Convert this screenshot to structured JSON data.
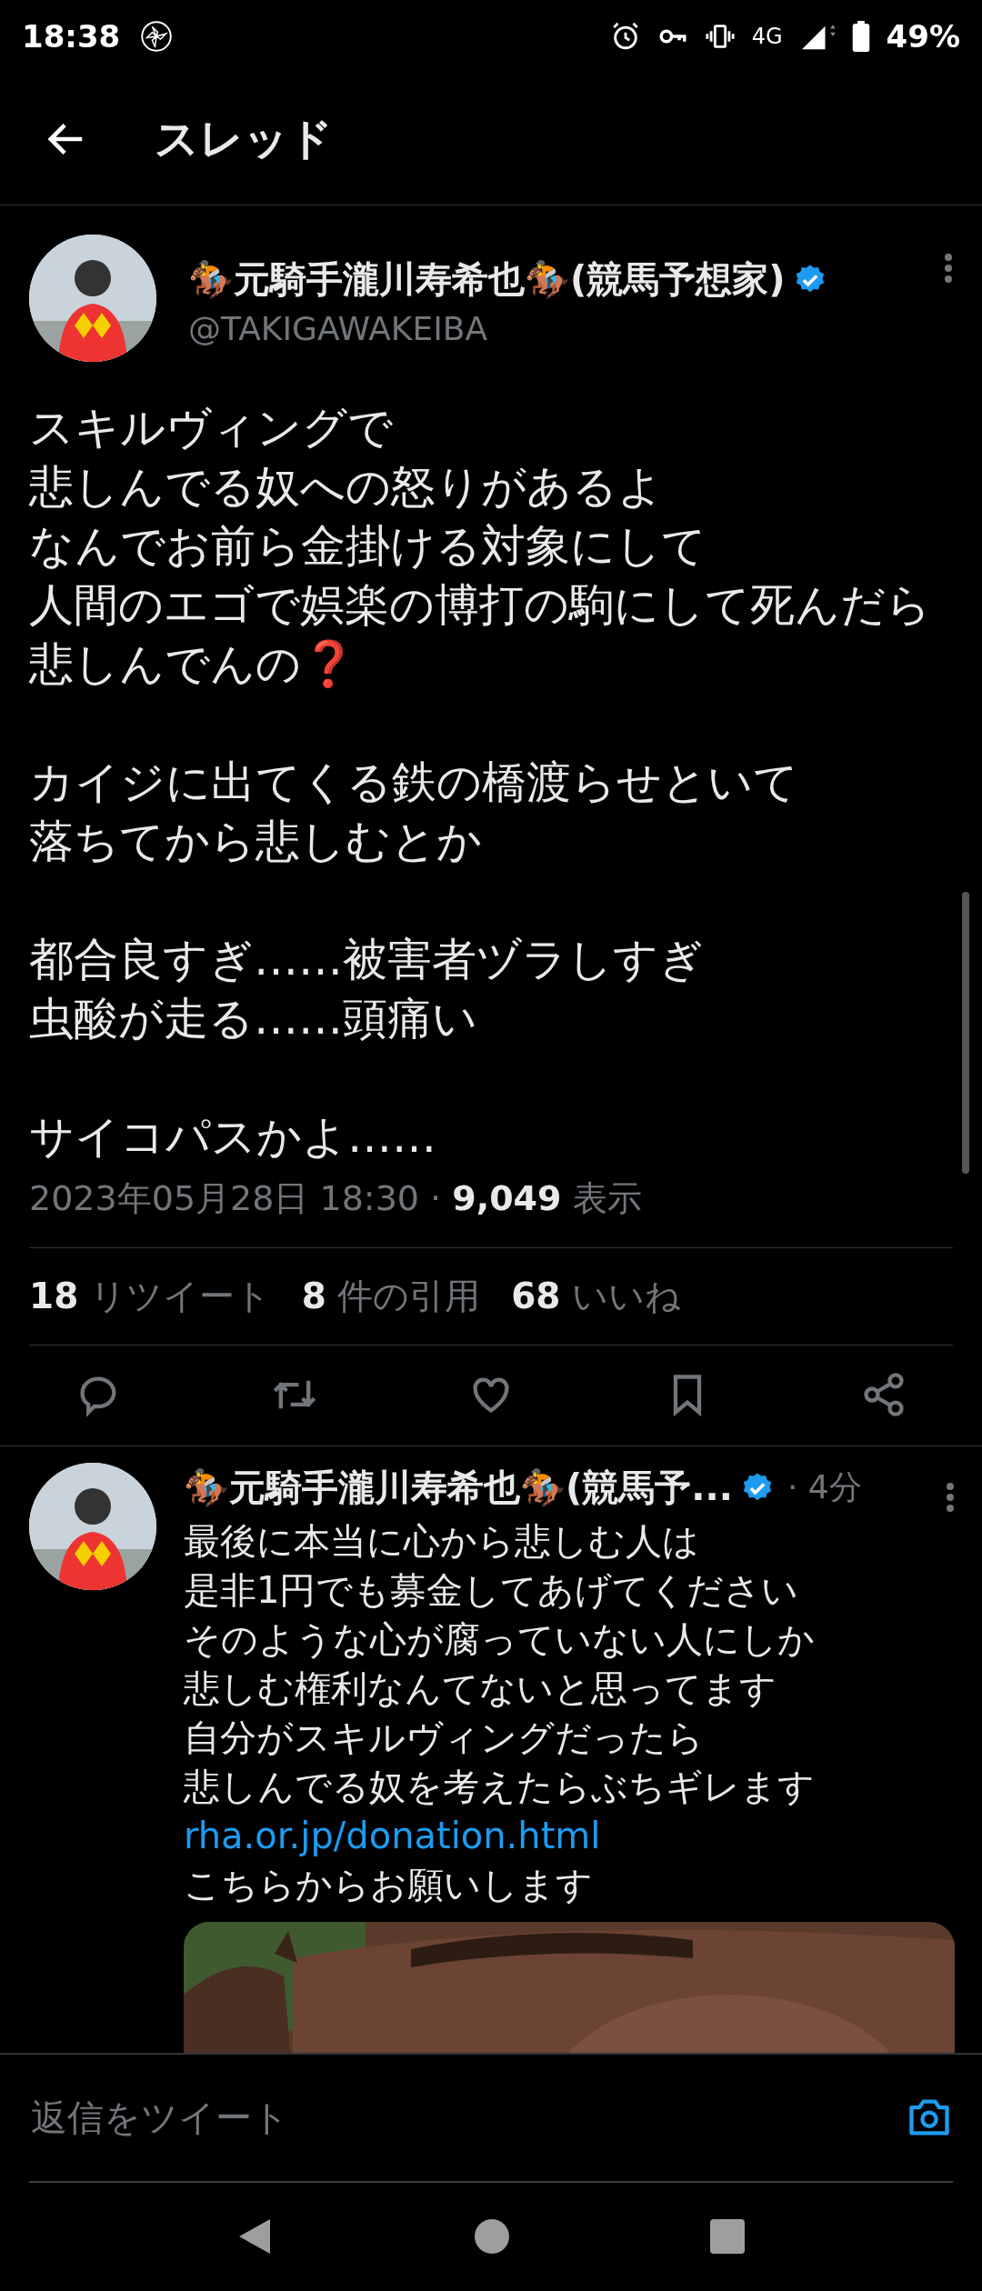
{
  "status_bar": {
    "time": "18:38",
    "network": "4G",
    "battery": "49%"
  },
  "header": {
    "title": "スレッド"
  },
  "tweet": {
    "name": "🏇元騎手瀧川寿希也🏇(競馬予想家)",
    "verified": true,
    "handle": "@TAKIGAWAKEIBA",
    "paragraphs": [
      [
        "スキルヴィングで",
        "悲しんでる奴への怒りがあるよ",
        "なんでお前ら金掛ける対象にして",
        "人間のエゴで娯楽の博打の駒にして死んだら",
        "悲しんでんの❓"
      ],
      [
        "カイジに出てくる鉄の橋渡らせといて",
        "落ちてから悲しむとか"
      ],
      [
        "都合良すぎ……被害者ヅラしすぎ",
        "虫酸が走る……頭痛い"
      ],
      [
        "サイコパスかよ……"
      ]
    ],
    "timestamp": "2023年05月28日 18:30",
    "separator": "·",
    "views_count": "9,049",
    "views_label": "表示",
    "stats": [
      {
        "count": "18",
        "label": "リツイート"
      },
      {
        "count": "8",
        "label": "件の引用"
      },
      {
        "count": "68",
        "label": "いいね"
      }
    ]
  },
  "reply": {
    "name": "🏇元騎手瀧川寿希也🏇(競馬予...",
    "verified": true,
    "time": "· 4分",
    "lines": [
      {
        "kind": "text",
        "text": "最後に本当に心から悲しむ人は"
      },
      {
        "kind": "text",
        "text": "是非1円でも募金してあげてください"
      },
      {
        "kind": "text",
        "text": "そのような心が腐っていない人にしか"
      },
      {
        "kind": "text",
        "text": "悲しむ権利なんてないと思ってます"
      },
      {
        "kind": "text",
        "text": "自分がスキルヴィングだったら"
      },
      {
        "kind": "text",
        "text": "悲しんでる奴を考えたらぶちギレます"
      },
      {
        "kind": "link",
        "text": "rha.or.jp/donation.html"
      },
      {
        "kind": "text",
        "text": "こちらからお願いします"
      }
    ]
  },
  "compose": {
    "placeholder": "返信をツイート"
  }
}
